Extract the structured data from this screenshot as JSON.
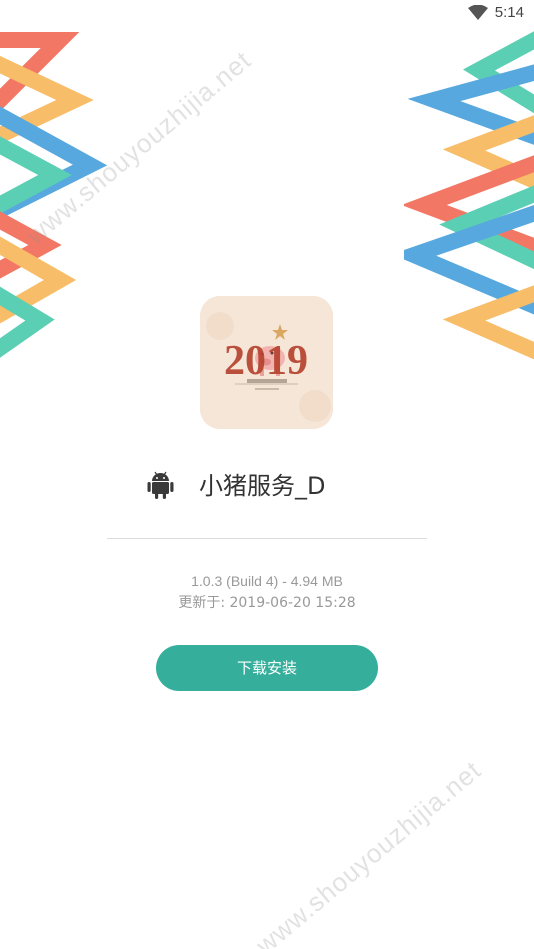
{
  "status_bar": {
    "time": "5:14",
    "wifi_icon": "wifi-icon"
  },
  "watermark": {
    "text": "www.shouyouzhijia.net"
  },
  "app": {
    "icon": "app-icon-2019-pig",
    "icon_text": "2019",
    "platform_icon": "android-icon",
    "name": "小猪服务_D",
    "version": "1.0.3 (Build 4) - 4.94 MB",
    "updated": "更新于: 2019-06-20 15:28"
  },
  "actions": {
    "install_label": "下载安装"
  },
  "colors": {
    "accent": "#35af9b",
    "stripe_red": "#f0604a",
    "stripe_orange": "#f7b24e",
    "stripe_blue": "#3a9ad9",
    "stripe_teal": "#3fc7a8"
  }
}
